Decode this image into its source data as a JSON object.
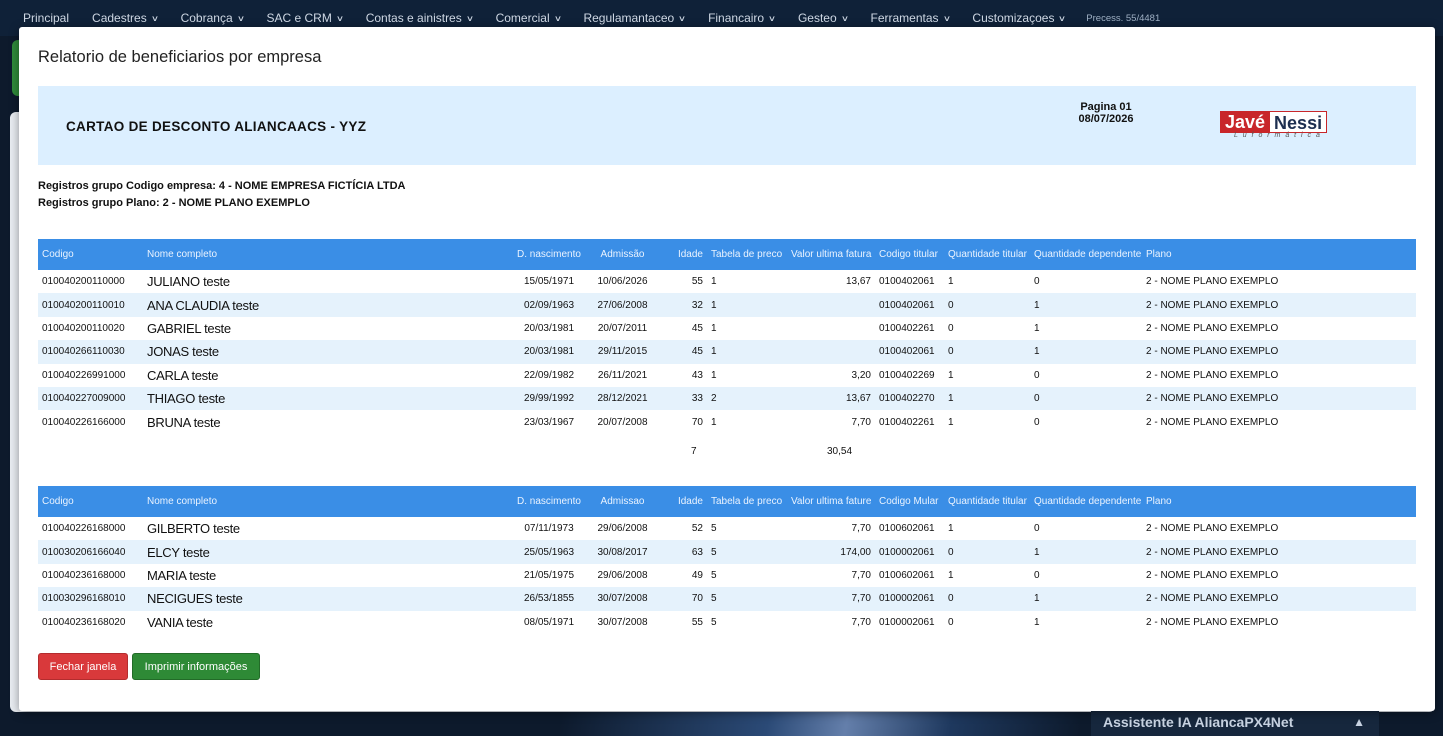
{
  "nav": {
    "items": [
      "Principal",
      "Cadestres",
      "Cobrança",
      "SAC e CRM",
      "Contas e ainistres",
      "Comercial",
      "Regulamantaceo",
      "Financairo",
      "Gesteo",
      "Ferramentas",
      "Customizaçoes"
    ],
    "process_label": "Precess. 55/4481"
  },
  "modal": {
    "title": "Relatorio de beneficiarios por empresa",
    "company_name": "CARTAO DE DESCONTO ALIANCAACS - YYZ",
    "page_label": "Pagina 01",
    "date": "08/07/2026",
    "logo_text_a": "Javé",
    "logo_text_b": "Nessi",
    "logo_subtext": "L u f o r m á t i c a",
    "group_company": "Registros grupo Codigo empresa: 4 - NOME EMPRESA FICTÍCIA LTDA",
    "group_plan": "Registros grupo Plano: 2 - NOME PLANO EXEMPLO"
  },
  "table1": {
    "headers": [
      "Codigo",
      "Nome completo",
      "D. nascimento",
      "Admissão",
      "Idade",
      "Tabela de preco",
      "Valor ultima fatura",
      "Codigo titular",
      "Quantidade titular",
      "Quantidade dependente",
      "Plano"
    ],
    "rows": [
      [
        "010040200110000",
        "JULIANO teste",
        "15/05/1971",
        "10/06/2026",
        "55",
        "1",
        "13,67",
        "0100402061",
        "1",
        "0",
        "2 - NOME PLANO EXEMPLO"
      ],
      [
        "010040200110010",
        "ANA CLAUDIA teste",
        "02/09/1963",
        "27/06/2008",
        "32",
        "1",
        "",
        "0100402061",
        "0",
        "1",
        "2 - NOME PLANO EXEMPLO"
      ],
      [
        "010040200110020",
        "GABRIEL teste",
        "20/03/1981",
        "20/07/2011",
        "45",
        "1",
        "",
        "0100402261",
        "0",
        "1",
        "2 - NOME PLANO EXEMPLO"
      ],
      [
        "010040266110030",
        "JONAS teste",
        "20/03/1981",
        "29/11/2015",
        "45",
        "1",
        "",
        "0100402061",
        "0",
        "1",
        "2 - NOME PLANO EXEMPLO"
      ],
      [
        "010040226991000",
        "CARLA teste",
        "22/09/1982",
        "26/11/2021",
        "43",
        "1",
        "3,20",
        "0100402269",
        "1",
        "0",
        "2 - NOME PLANO EXEMPLO"
      ],
      [
        "010040227009000",
        "THIAGO teste",
        "29/99/1992",
        "28/12/2021",
        "33",
        "2",
        "13,67",
        "0100402270",
        "1",
        "0",
        "2 - NOME PLANO EXEMPLO"
      ],
      [
        "010040226166000",
        "BRUNA teste",
        "23/03/1967",
        "20/07/2008",
        "70",
        "1",
        "7,70",
        "0100402261",
        "1",
        "0",
        "2 - NOME PLANO EXEMPLO"
      ]
    ],
    "total_count": "7",
    "total_value": "30,54"
  },
  "table2": {
    "headers": [
      "Codigo",
      "Nome completo",
      "D. nascimento",
      "Admissao",
      "Idade",
      "Tabela de preco",
      "Valor ultima fature",
      "Codigo Mular",
      "Quantidade titular",
      "Quantidade dependente",
      "Plano"
    ],
    "rows": [
      [
        "010040226168000",
        "GILBERTO teste",
        "07/11/1973",
        "29/06/2008",
        "52",
        "5",
        "7,70",
        "0100602061",
        "1",
        "0",
        "2 - NOME PLANO EXEMPLO"
      ],
      [
        "010030206166040",
        "ELCY teste",
        "25/05/1963",
        "30/08/2017",
        "63",
        "5",
        "174,00",
        "0100002061",
        "0",
        "1",
        "2 - NOME PLANO EXEMPLO"
      ],
      [
        "010040236168000",
        "MARIA teste",
        "21/05/1975",
        "29/06/2008",
        "49",
        "5",
        "7,70",
        "0100602061",
        "1",
        "0",
        "2 - NOME PLANO EXEMPLO"
      ],
      [
        "010030296168010",
        "NECIGUES teste",
        "26/53/1855",
        "30/07/2008",
        "70",
        "5",
        "7,70",
        "0100002061",
        "0",
        "1",
        "2 - NOME PLANO EXEMPLO"
      ],
      [
        "010040236168020",
        "VANIA teste",
        "08/05/1971",
        "30/07/2008",
        "55",
        "5",
        "7,70",
        "0100002061",
        "0",
        "1",
        "2 - NOME PLANO EXEMPLO"
      ]
    ]
  },
  "buttons": {
    "close": "Fechar janela",
    "print": "Imprimir informações"
  },
  "assistant": {
    "label": "Assistente IA AliancaPX4Net"
  },
  "colors": {
    "header_blue": "#3a8ee6",
    "row_alt": "#e5f2fc",
    "report_header_bg": "#dcefff",
    "close_red": "#d9393b",
    "print_green": "#2e8a36"
  }
}
